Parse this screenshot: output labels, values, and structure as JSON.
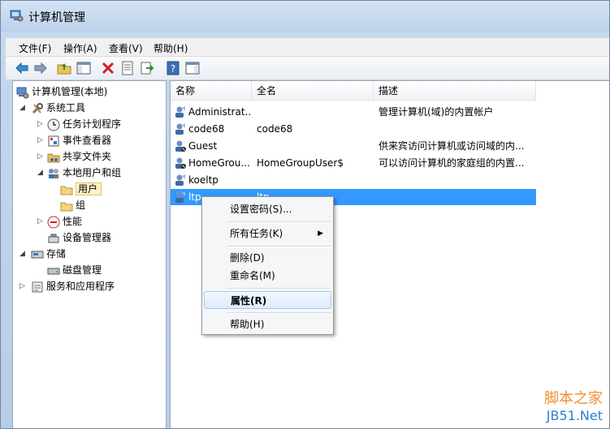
{
  "window": {
    "title": "计算机管理"
  },
  "menubar": [
    {
      "label": "文件(F)"
    },
    {
      "label": "操作(A)"
    },
    {
      "label": "查看(V)"
    },
    {
      "label": "帮助(H)"
    }
  ],
  "toolbar": {
    "icons": [
      "back-arrow-icon",
      "forward-arrow-icon",
      "up-folder-icon",
      "show-hide-tree-icon",
      "delete-icon",
      "properties-icon",
      "export-icon",
      "help-icon",
      "show-hide-action-pane-icon"
    ]
  },
  "tree": {
    "root": "计算机管理(本地)",
    "system_tools": "系统工具",
    "task_scheduler": "任务计划程序",
    "event_viewer": "事件查看器",
    "shared_folders": "共享文件夹",
    "local_users_groups": "本地用户和组",
    "users": "用户",
    "groups": "组",
    "performance": "性能",
    "device_manager": "设备管理器",
    "storage": "存储",
    "disk_management": "磁盘管理",
    "services_apps": "服务和应用程序"
  },
  "list": {
    "columns": [
      "名称",
      "全名",
      "描述"
    ],
    "rows": [
      {
        "name": "Administrat...",
        "fullname": "",
        "desc": "管理计算机(域)的内置帐户"
      },
      {
        "name": "code68",
        "fullname": "code68",
        "desc": ""
      },
      {
        "name": "Guest",
        "fullname": "",
        "desc": "供来宾访问计算机或访问域的内..."
      },
      {
        "name": "HomeGrou...",
        "fullname": "HomeGroupUser$",
        "desc": "可以访问计算机的家庭组的内置..."
      },
      {
        "name": "koeltp",
        "fullname": "",
        "desc": ""
      },
      {
        "name": "ltp",
        "fullname": "ltp",
        "desc": ""
      }
    ]
  },
  "context_menu": {
    "set_password": "设置密码(S)...",
    "all_tasks": "所有任务(K)",
    "delete": "删除(D)",
    "rename": "重命名(M)",
    "properties": "属性(R)",
    "help": "帮助(H)"
  },
  "watermark": {
    "line1": "脚本之家",
    "line2": "JB51.Net"
  },
  "colors": {
    "selection": "#3399ff",
    "accent": "#f08f2b",
    "link_blue": "#2a7fcf"
  }
}
